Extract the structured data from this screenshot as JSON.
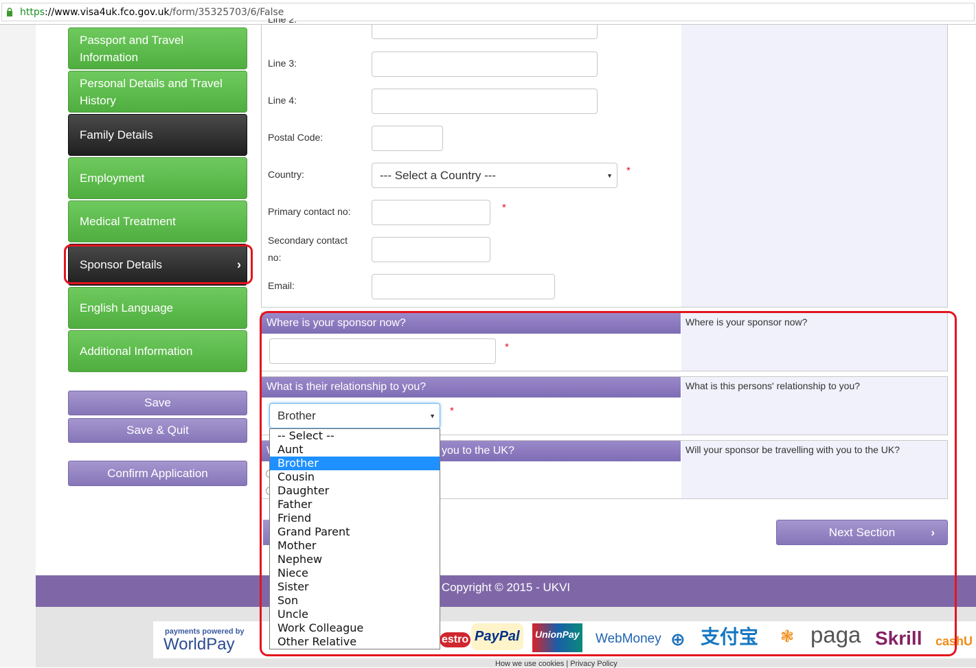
{
  "browser": {
    "url_scheme": "https",
    "url_host": "://www.visa4uk.fco.gov.uk",
    "url_path": "/form/35325703/6/False"
  },
  "sidebar": {
    "items": [
      {
        "label": "Passport and Travel Information",
        "state": "complete"
      },
      {
        "label": "Personal Details and Travel History",
        "state": "complete"
      },
      {
        "label": "Family Details",
        "state": "dark"
      },
      {
        "label": "Employment",
        "state": "complete"
      },
      {
        "label": "Medical Treatment",
        "state": "complete"
      },
      {
        "label": "Sponsor Details",
        "state": "current"
      },
      {
        "label": "English Language",
        "state": "complete"
      },
      {
        "label": "Additional Information",
        "state": "complete"
      }
    ],
    "save_label": "Save",
    "save_quit_label": "Save & Quit",
    "confirm_label": "Confirm Application"
  },
  "address_form": {
    "line2_label": "Line 2:",
    "line3_label": "Line 3:",
    "line4_label": "Line 4:",
    "postal_label": "Postal Code:",
    "country_label": "Country:",
    "country_value": "--- Select a Country ---",
    "primary_label": "Primary contact no:",
    "secondary_label": "Secondary contact no:",
    "email_label": "Email:",
    "required_mark": "*"
  },
  "sections": {
    "where": {
      "title": "Where is your sponsor now?",
      "help": "Where is your sponsor now?",
      "value": ""
    },
    "relationship": {
      "title": "What is their relationship to you?",
      "help": "What is this persons' relationship to you?",
      "value": "Brother"
    },
    "travelling": {
      "title_start": "W",
      "title_end": "you to the UK?",
      "help": "Will your sponsor be travelling with you to the UK?"
    }
  },
  "dropdown": {
    "options": [
      "-- Select --",
      "Aunt",
      "Brother",
      "Cousin",
      "Daughter",
      "Father",
      "Friend",
      "Grand Parent",
      "Mother",
      "Nephew",
      "Niece",
      "Sister",
      "Son",
      "Uncle",
      "Work Colleague",
      "Other Relative"
    ],
    "selected": "Brother"
  },
  "next_label": "Next Section",
  "footer": {
    "copyright": "Copyright © 2015 - UKVI",
    "links": "How we use cookies   |   Privacy Policy",
    "payments": {
      "worldpay_small": "payments powered by",
      "worldpay": "WorldPay",
      "maestro": "estro",
      "paypal": "PayPal",
      "unionpay": "UnionPay",
      "webmoney": "WebMoney",
      "alipay": "支付宝",
      "paga": "paga",
      "skrill": "Skrill",
      "cashu": "cashU"
    }
  },
  "colors": {
    "nav_green": "#5cba4a",
    "nav_dark": "#2c2c2c",
    "accent_purple": "#8676b8",
    "highlight_red": "#e3141e",
    "dropdown_selected": "#1e90ff"
  }
}
